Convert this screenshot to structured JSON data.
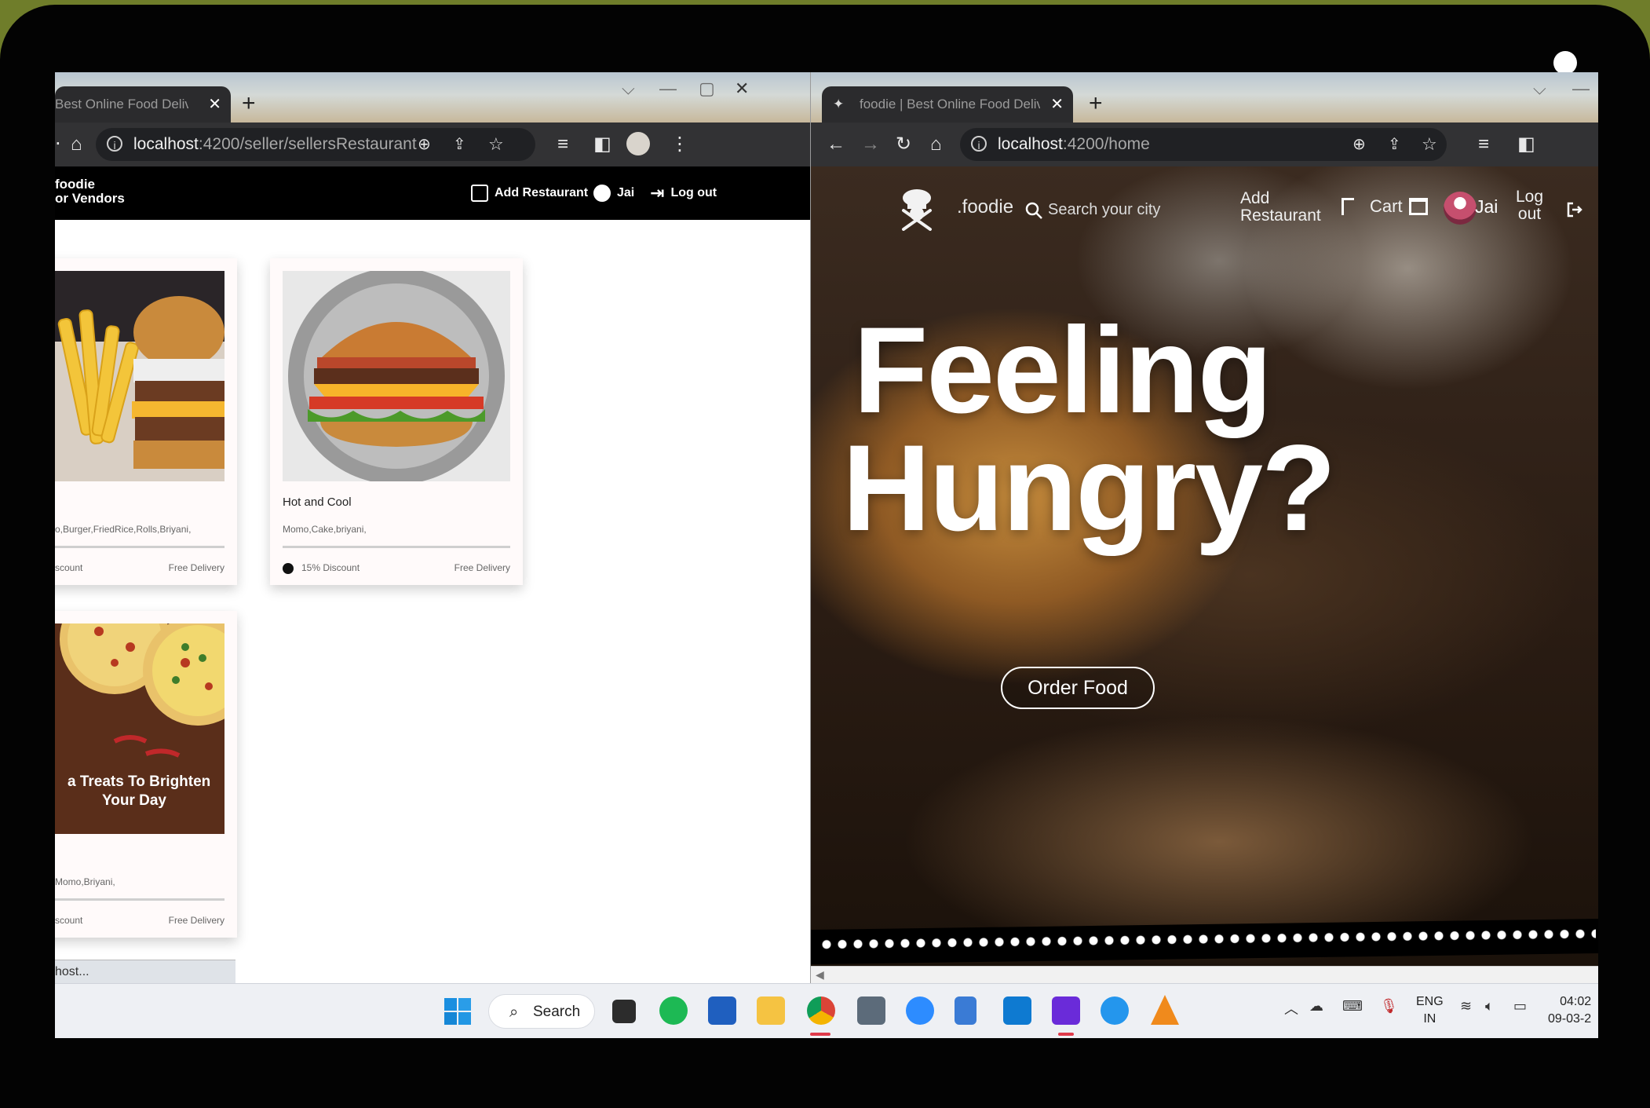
{
  "left_browser": {
    "tab_title": "Best Online Food Delivery",
    "address_host": "localhost",
    "address_path": ":4200/seller/sellersRestaurant",
    "status_text": "host..."
  },
  "right_browser": {
    "tab_title": "foodie | Best Online Food Delivery",
    "address_host": "localhost",
    "address_path": ":4200/home"
  },
  "vendor_app": {
    "brand_line1": "foodie",
    "brand_line2": "or Vendors",
    "nav": {
      "add_restaurant": "Add Restaurant",
      "user": "Jai",
      "logout": "Log out"
    },
    "cards": [
      {
        "name": "",
        "cuisines": "o,Burger,FriedRice,Rolls,Briyani,",
        "discount": "scount",
        "delivery": "Free Delivery"
      },
      {
        "name": "Hot and Cool",
        "cuisines": "Momo,Cake,briyani,",
        "discount": "15% Discount",
        "delivery": "Free Delivery"
      },
      {
        "name": "",
        "image_caption_line1": "a Treats To Brighten",
        "image_caption_line2": "Your Day",
        "cuisines": "Momo,Briyani,",
        "discount": "scount",
        "delivery": "Free Delivery"
      }
    ]
  },
  "home_app": {
    "brand": ".foodie",
    "search_placeholder": "Search your city",
    "add_restaurant_line1": "Add",
    "add_restaurant_line2": "Restaurant",
    "cart": "Cart",
    "user": "Jai",
    "logout_line1": "Log",
    "logout_line2": "out",
    "hero_line1": "Feeling",
    "hero_line2": "Hungry?",
    "order_button": "Order Food"
  },
  "taskbar": {
    "search_label": "Search",
    "lang_line1": "ENG",
    "lang_line2": "IN",
    "time": "04:02",
    "date": "09-03-2"
  },
  "colors": {
    "vendor_nav_bg": "#000000",
    "toolbar_bg": "#323234",
    "chrome_active_indicator": "#e03b4b",
    "taskbar_bg": "#eef0f4"
  }
}
